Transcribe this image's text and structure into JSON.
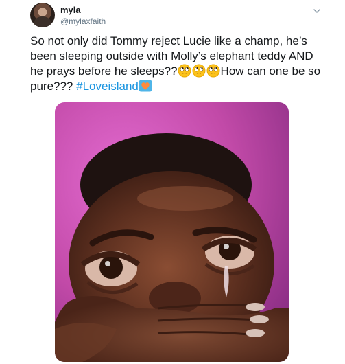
{
  "author": {
    "display_name": "myla",
    "handle": "@mylaxfaith"
  },
  "icons": {
    "menu": "chevron-down-icon",
    "emoji": "rolling-eyes-emoji-icon",
    "hashtag_badge": "love-island-heart-icon"
  },
  "tweet": {
    "text_part1": "So not only did Tommy reject Lucie like a champ, he’s been sleeping outside with Molly’s elephant teddy AND he prays before he sleeps??",
    "text_part2": "How can one be so pure??? ",
    "hashtag": "#Loveisland"
  },
  "media": {
    "description_icon": "crying-face-meme-image"
  },
  "colors": {
    "link": "#1b95e0",
    "text": "#14171a",
    "secondary": "#657786",
    "media_background": "#c24aa8"
  }
}
